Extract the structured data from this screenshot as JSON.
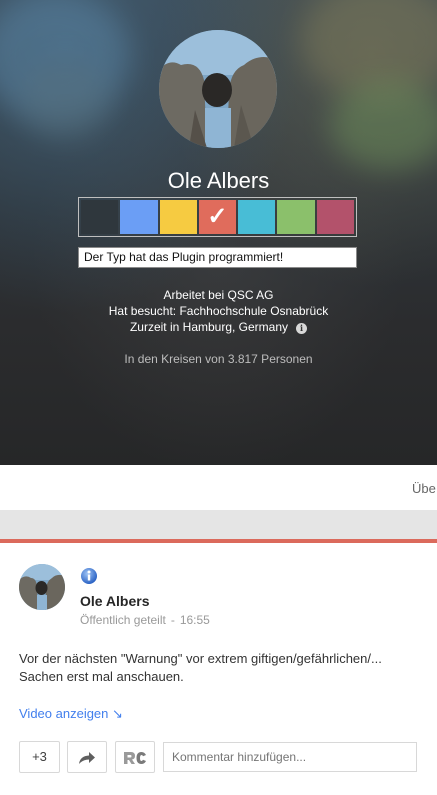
{
  "profile": {
    "name": "Ole Albers",
    "tagline": "Der Typ hat das Plugin programmiert!",
    "work": "Arbeitet bei QSC AG",
    "education": "Hat besucht: Fachhochschule Osnabrück",
    "location": "Zurzeit in Hamburg, Germany",
    "circles": "In den Kreisen von 3.817 Personen",
    "color_swatches": [
      {
        "color": "#2f373d",
        "selected": false
      },
      {
        "color": "#6b9ef5",
        "selected": false
      },
      {
        "color": "#f6cb41",
        "selected": false
      },
      {
        "color": "#e06c5c",
        "selected": true
      },
      {
        "color": "#48bdd6",
        "selected": false
      },
      {
        "color": "#8bc06b",
        "selected": false
      },
      {
        "color": "#b3526b",
        "selected": false
      }
    ],
    "check_glyph": "✓"
  },
  "tabs": {
    "partial_label": "Übe"
  },
  "post": {
    "author": "Ole Albers",
    "visibility": "Öffentlich geteilt",
    "separator": "-",
    "time": "16:55",
    "text_line1": "Vor der nächsten \"Warnung\" vor extrem giftigen/gefährlichen/...",
    "text_line2": "Sachen erst mal anschauen.",
    "video_link": "Video anzeigen ↘",
    "plus_one": "+3",
    "comment_placeholder": "Kommentar hinzufügen..."
  },
  "colors": {
    "accent_red": "#db6a5c",
    "link_blue": "#427fed"
  }
}
